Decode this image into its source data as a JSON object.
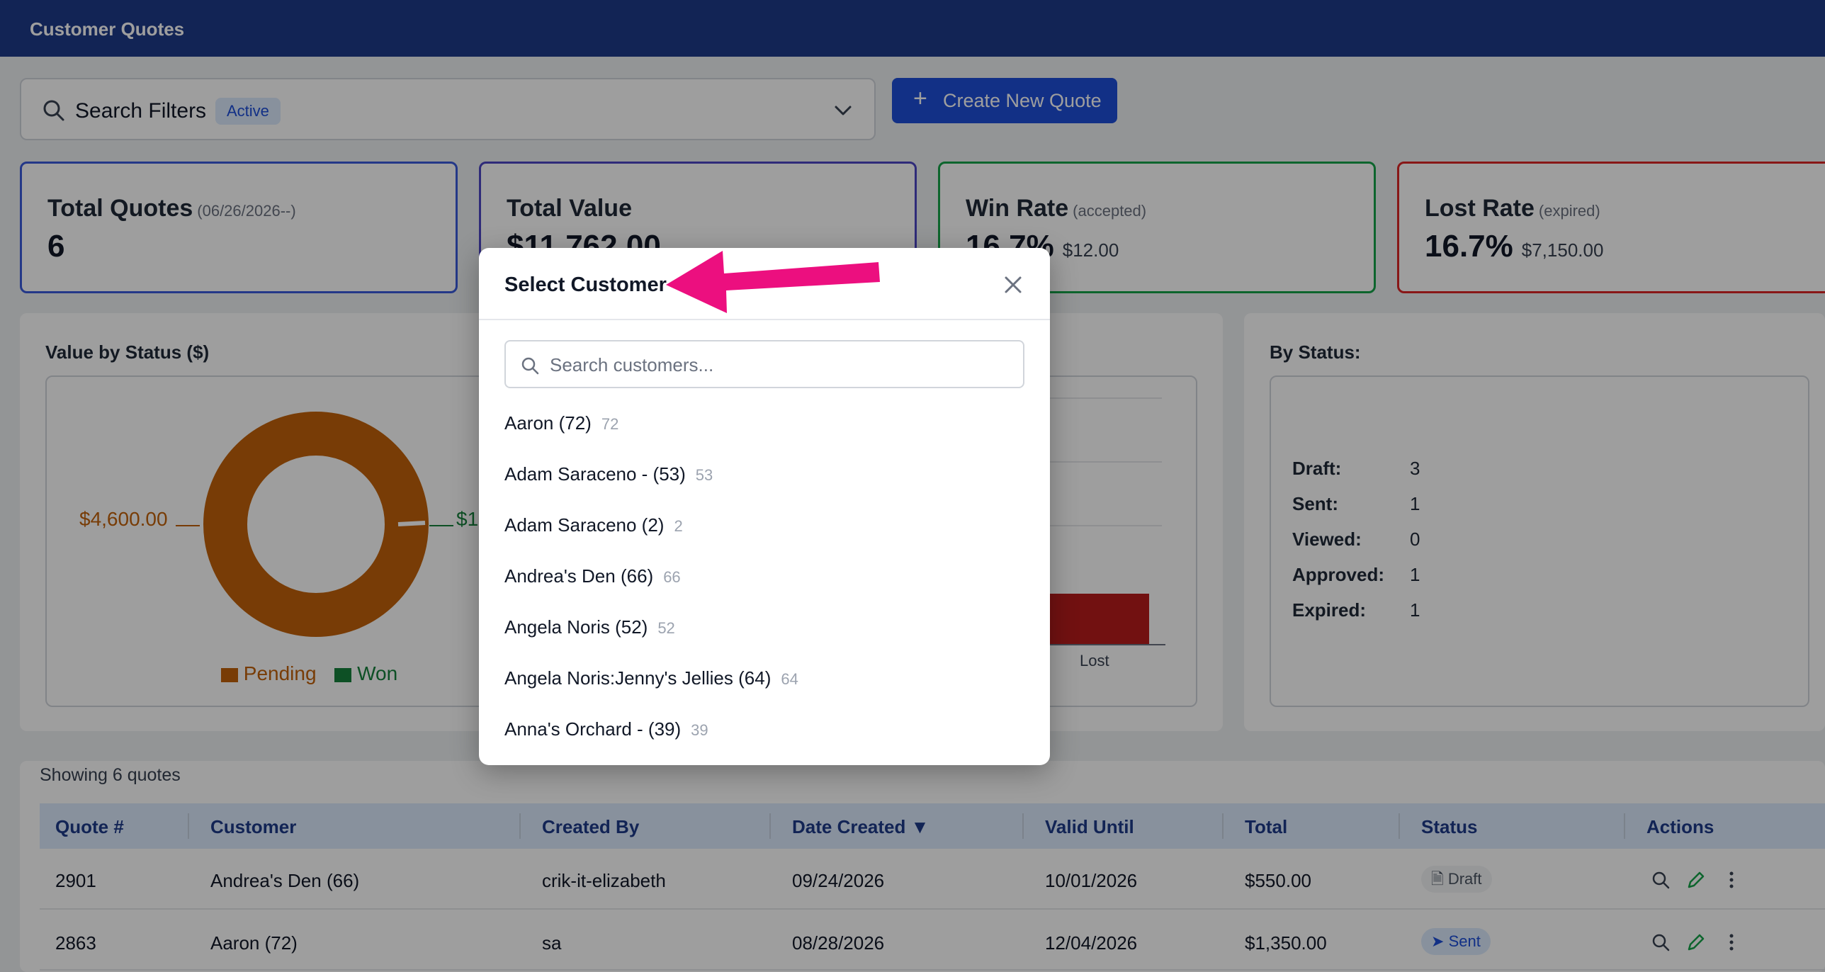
{
  "app": {
    "title": "Customer Quotes"
  },
  "filters": {
    "label": "Search Filters",
    "badge": "Active"
  },
  "actions": {
    "new_quote": "Create New Quote"
  },
  "cards": [
    {
      "title": "Total Quotes",
      "note": "(06/26/2026--)",
      "value": "6",
      "sub": "",
      "border": "#3b5bdb"
    },
    {
      "title": "Total Value",
      "note": "",
      "value": "$11,762.00",
      "sub": "",
      "border": "#4c46c4"
    },
    {
      "title": "Win Rate",
      "note": "(accepted)",
      "value": "16.7%",
      "sub": "$12.00",
      "border": "#16a34a"
    },
    {
      "title": "Lost Rate",
      "note": "(expired)",
      "value": "16.7%",
      "sub": "$7,150.00",
      "border": "#dc2626"
    }
  ],
  "donut": {
    "title": "Value by Status ($)",
    "left_label": "$4,600.00",
    "right_label": "$1",
    "legend": [
      {
        "name": "Pending",
        "color": "#c2620a"
      },
      {
        "name": "Won",
        "color": "#16813d"
      }
    ]
  },
  "bar": {
    "label": "Lost",
    "color": "#b91c1c"
  },
  "status_panel": {
    "title": "By Status:",
    "rows": [
      {
        "k": "Draft:",
        "v": "3"
      },
      {
        "k": "Sent:",
        "v": "1"
      },
      {
        "k": "Viewed:",
        "v": "0"
      },
      {
        "k": "Approved:",
        "v": "1"
      },
      {
        "k": "Expired:",
        "v": "1"
      }
    ]
  },
  "table": {
    "showing": "Showing 6 quotes",
    "headers": [
      "Quote #",
      "Customer",
      "Created By",
      "Date Created ▼",
      "Valid Until",
      "Total",
      "Status",
      "Actions"
    ],
    "rows": [
      {
        "quote": "2901",
        "customer": "Andrea's Den (66)",
        "created_by": "crik-it-elizabeth",
        "date": "09/24/2026",
        "valid": "10/01/2026",
        "total": "$550.00",
        "status": "Draft"
      },
      {
        "quote": "2863",
        "customer": "Aaron (72)",
        "created_by": "sa",
        "date": "08/28/2026",
        "valid": "12/04/2026",
        "total": "$1,350.00",
        "status": "Sent"
      }
    ]
  },
  "modal": {
    "title": "Select Customer",
    "search_placeholder": "Search customers...",
    "customers": [
      {
        "name": "Aaron (72)",
        "id": "72"
      },
      {
        "name": "Adam Saraceno - (53)",
        "id": "53"
      },
      {
        "name": "Adam Saraceno (2)",
        "id": "2"
      },
      {
        "name": "Andrea's Den (66)",
        "id": "66"
      },
      {
        "name": "Angela Noris (52)",
        "id": "52"
      },
      {
        "name": "Angela Noris:Jenny's Jellies (64)",
        "id": "64"
      },
      {
        "name": "Anna's Orchard - (39)",
        "id": "39"
      }
    ]
  },
  "annotation": {
    "color": "#ec0f7f",
    "icon": "pointer-arrow"
  }
}
